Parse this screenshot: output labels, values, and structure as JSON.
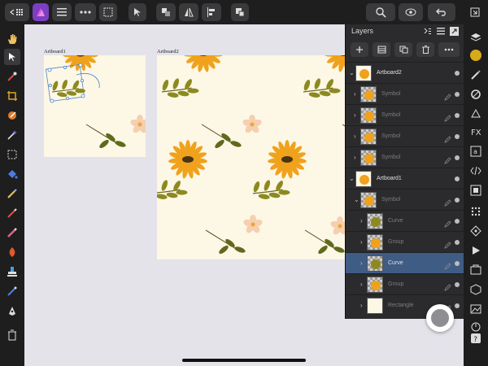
{
  "toolbar": {
    "back_icon": "back-grid-icon",
    "app_icon": "affinity-designer-icon",
    "menu_icon": "hamburger-menu-icon",
    "more_icon": "ellipsis-icon",
    "snapping_icon": "snapping-grid-icon",
    "move_icon": "move-tool-icon",
    "arrange_icon": "arrange-icon",
    "flip_icon": "flip-icon",
    "align_icon": "align-icon",
    "boolean_icon": "boolean-add-icon",
    "zoom_icon": "zoom-icon",
    "view_icon": "view-mode-icon",
    "undo_icon": "undo-icon",
    "fullscreen_icon": "fullscreen-icon"
  },
  "canvas": {
    "artboard1_label": "Artboard1",
    "artboard2_label": "Artboard2",
    "background_color": "#fdf7e6"
  },
  "layers_panel": {
    "title": "Layers",
    "layers": [
      {
        "name": "Artboard2",
        "level": 0,
        "dimmed": false,
        "selected": false
      },
      {
        "name": "Symbol",
        "level": 1,
        "dimmed": true,
        "selected": false
      },
      {
        "name": "Symbol",
        "level": 1,
        "dimmed": true,
        "selected": false
      },
      {
        "name": "Symbol",
        "level": 1,
        "dimmed": true,
        "selected": false
      },
      {
        "name": "Symbol",
        "level": 1,
        "dimmed": true,
        "selected": false
      },
      {
        "name": "Artboard1",
        "level": 0,
        "dimmed": false,
        "selected": false
      },
      {
        "name": "Symbol",
        "level": 1,
        "dimmed": true,
        "selected": false
      },
      {
        "name": "Curve",
        "level": 2,
        "dimmed": true,
        "selected": false
      },
      {
        "name": "Group",
        "level": 2,
        "dimmed": true,
        "selected": false
      },
      {
        "name": "Curve",
        "level": 2,
        "dimmed": false,
        "selected": true
      },
      {
        "name": "Group",
        "level": 2,
        "dimmed": true,
        "selected": false
      },
      {
        "name": "Rectangle",
        "level": 2,
        "dimmed": true,
        "selected": false
      }
    ]
  },
  "colors": {
    "accent": "#3f5c85",
    "petal": "#f0a21c",
    "leaf": "#8c8a1f",
    "pink": "#f6cfae",
    "fill_swatch": "#d6ab17"
  }
}
